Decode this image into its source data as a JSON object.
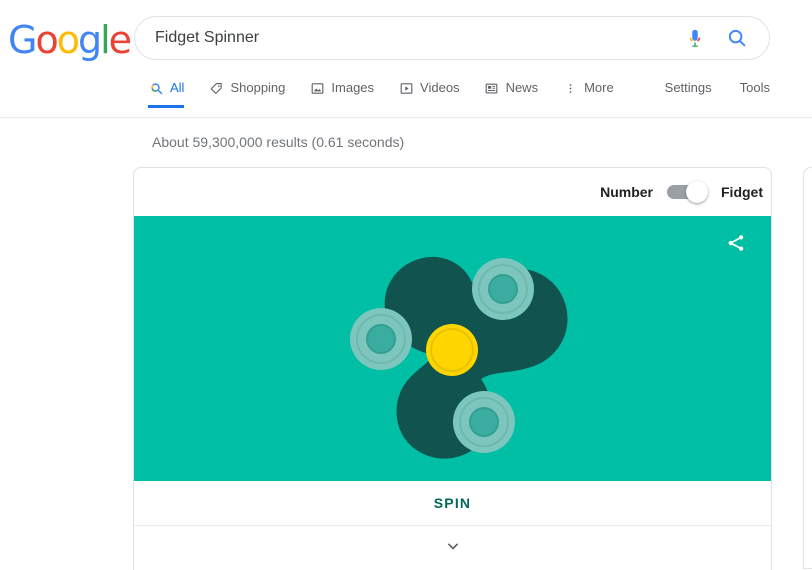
{
  "brand": {
    "logo_letters": [
      {
        "char": "G",
        "color": "#4285F4"
      },
      {
        "char": "o",
        "color": "#EA4335"
      },
      {
        "char": "o",
        "color": "#FBBC05"
      },
      {
        "char": "g",
        "color": "#4285F4"
      },
      {
        "char": "l",
        "color": "#34A853"
      },
      {
        "char": "e",
        "color": "#EA4335"
      }
    ]
  },
  "search": {
    "value": "Fidget Spinner",
    "placeholder": "Search",
    "voice_icon": "microphone-icon",
    "submit_icon": "search-icon"
  },
  "nav": {
    "tabs": [
      {
        "label": "All",
        "icon": "search-icon",
        "active": true
      },
      {
        "label": "Shopping",
        "icon": "tag-icon",
        "active": false
      },
      {
        "label": "Images",
        "icon": "image-icon",
        "active": false
      },
      {
        "label": "Videos",
        "icon": "video-icon",
        "active": false
      },
      {
        "label": "News",
        "icon": "newspaper-icon",
        "active": false
      },
      {
        "label": "More",
        "icon": "more-vertical-icon",
        "active": false
      }
    ],
    "settings_label": "Settings",
    "tools_label": "Tools"
  },
  "results": {
    "stats": "About 59,300,000 results (0.61 seconds)"
  },
  "doodle": {
    "toggle": {
      "left_label": "Number",
      "right_label": "Fidget",
      "state": "right"
    },
    "share_icon": "share-icon",
    "spin_label": "SPIN",
    "expand_icon": "chevron-down-icon",
    "colors": {
      "stage_background": "#00bfa5",
      "spinner_body": "#10534f",
      "bearing_outer": "#7cc6bd",
      "bearing_inner": "#3aada0",
      "hub": "#ffd500",
      "spin_text": "#00695c",
      "toggle_track": "#9aa0a6",
      "toggle_knob": "#ffffff"
    }
  }
}
